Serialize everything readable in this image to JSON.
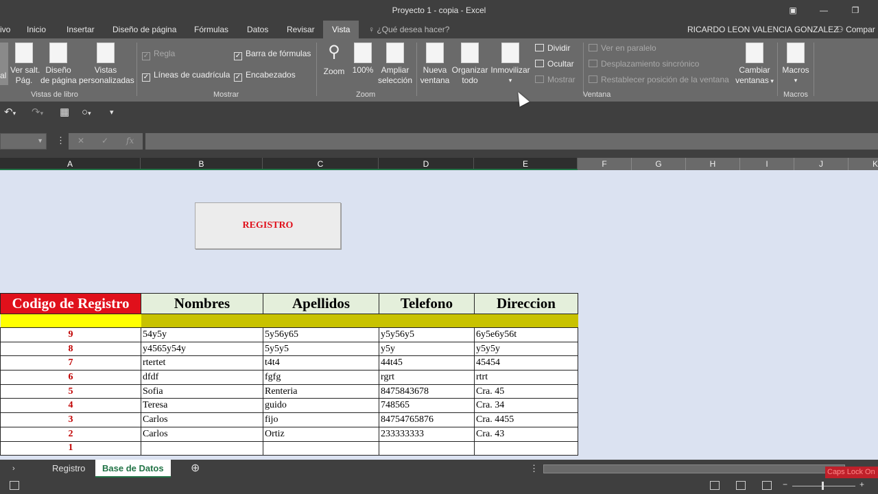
{
  "window": {
    "title": "Proyecto 1 - copia - Excel"
  },
  "tabs": [
    {
      "label": "ivo"
    },
    {
      "label": "Inicio"
    },
    {
      "label": "Insertar"
    },
    {
      "label": "Diseño de página"
    },
    {
      "label": "Fórmulas"
    },
    {
      "label": "Datos"
    },
    {
      "label": "Revisar"
    },
    {
      "label": "Vista"
    }
  ],
  "tell_me": "¿Qué desea hacer?",
  "user_name": "RICARDO LEON VALENCIA GONZALEZ",
  "share_label": "Compar",
  "ribbon": {
    "vistas_libro": {
      "normal_label": "al",
      "saltos_label_1": "Ver salt.",
      "saltos_label_2": "Pág.",
      "diseno_label_1": "Diseño",
      "diseno_label_2": "de página",
      "personalizadas_label_1": "Vistas",
      "personalizadas_label_2": "personalizadas",
      "group_label": "Vistas de libro"
    },
    "mostrar": {
      "regla": "Regla",
      "lineas": "Líneas de cuadrícula",
      "barra": "Barra de fórmulas",
      "encabezados": "Encabezados",
      "group_label": "Mostrar"
    },
    "zoom": {
      "zoom_label": "Zoom",
      "cien_label": "100%",
      "ampliar_label_1": "Ampliar",
      "ampliar_label_2": "selección",
      "group_label": "Zoom"
    },
    "ventana": {
      "nueva_1": "Nueva",
      "nueva_2": "ventana",
      "organizar_1": "Organizar",
      "organizar_2": "todo",
      "inmovilizar": "Inmovilizar",
      "dividir": "Dividir",
      "ocultar": "Ocultar",
      "mostrar": "Mostrar",
      "paralelo": "Ver en paralelo",
      "sincronico": "Desplazamiento sincrónico",
      "restablecer": "Restablecer posición de la ventana",
      "cambiar_1": "Cambiar",
      "cambiar_2": "ventanas",
      "group_label": "Ventana"
    },
    "macros": {
      "label": "Macros",
      "group_label": "Macros"
    }
  },
  "formula_bar": {
    "cancel": "✕",
    "enter": "✓",
    "fx": "fx"
  },
  "columns": [
    "A",
    "B",
    "C",
    "D",
    "E",
    "F",
    "G",
    "H",
    "I",
    "J",
    "K"
  ],
  "register_button": "REGISTRO",
  "table": {
    "headers": [
      "Codigo de Registro",
      "Nombres",
      "Apellidos",
      "Telefono",
      "Direccion"
    ],
    "rows": [
      [
        "9",
        "54y5y",
        "5y56y65",
        "y5y56y5",
        "6y5e6y56t"
      ],
      [
        "8",
        "y4565y54y",
        "5y5y5",
        "y5y",
        "y5y5y"
      ],
      [
        "7",
        "rtertet",
        "t4t4",
        "44t45",
        "45454"
      ],
      [
        "6",
        "dfdf",
        "fgfg",
        "rgrt",
        "rtrt"
      ],
      [
        "5",
        "Sofia",
        "Renteria",
        "8475843678",
        "Cra. 45"
      ],
      [
        "4",
        "Teresa",
        "guido",
        "748565",
        "Cra. 34"
      ],
      [
        "3",
        "Carlos",
        "fijo",
        "84754765876",
        "Cra. 4455"
      ],
      [
        "2",
        "Carlos",
        "Ortiz",
        "233333333",
        "Cra. 43"
      ],
      [
        "1",
        "",
        "",
        "",
        ""
      ]
    ]
  },
  "sheets": [
    "Registro",
    "Base de Datos"
  ],
  "caps_lock": "Caps Lock On",
  "colors": {
    "excel_green": "#217346",
    "header_red": "#e0101b",
    "code_red": "#c00000",
    "yellow": "#ffff00",
    "olive": "#c8c200"
  }
}
